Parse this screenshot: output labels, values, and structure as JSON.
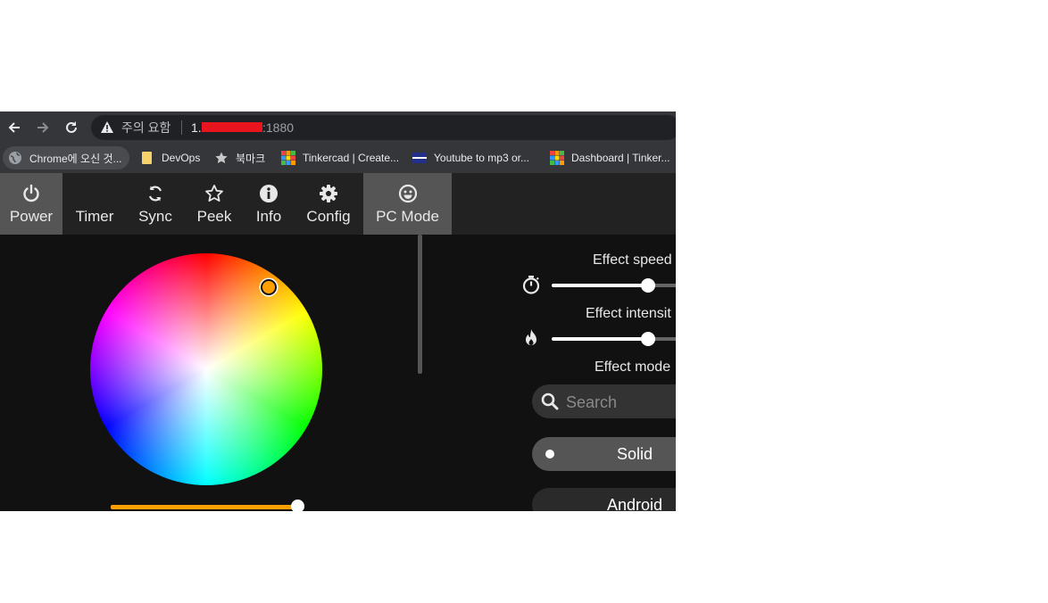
{
  "browser": {
    "warning_text": "주의 요함",
    "url_prefix": "1.",
    "url_port": ":1880",
    "bookmarks": [
      {
        "label": "Chrome에 오신 것...",
        "icon": "globe-icon"
      },
      {
        "label": "DevOps",
        "icon": "folder-icon"
      },
      {
        "label": "북마크",
        "icon": "star-icon"
      },
      {
        "label": "Tinkercad | Create...",
        "icon": "tinkercad-icon"
      },
      {
        "label": "Youtube to mp3 or...",
        "icon": "flag-icon"
      },
      {
        "label": "Dashboard | Tinker...",
        "icon": "tinkercad-icon"
      }
    ]
  },
  "nav": {
    "tabs": [
      {
        "label": "Power",
        "icon": "power-icon"
      },
      {
        "label": "Timer",
        "icon": "moon-icon"
      },
      {
        "label": "Sync",
        "icon": "sync-icon"
      },
      {
        "label": "Peek",
        "icon": "star-outline-icon"
      },
      {
        "label": "Info",
        "icon": "info-icon"
      },
      {
        "label": "Config",
        "icon": "gear-icon"
      },
      {
        "label": "PC Mode",
        "icon": "smiley-icon"
      }
    ]
  },
  "controls": {
    "effect_speed_label": "Effect speed",
    "effect_speed_value": 0.5,
    "effect_intensity_label": "Effect intensit",
    "effect_intensity_value": 0.5,
    "effect_mode_label": "Effect mode",
    "search_placeholder": "Search",
    "brightness_value": 0.97,
    "selected_color": "#ffa000",
    "accent_color": "#ffa000"
  },
  "effects": [
    {
      "label": "Solid",
      "selected": true
    },
    {
      "label": "Android",
      "selected": false
    }
  ]
}
